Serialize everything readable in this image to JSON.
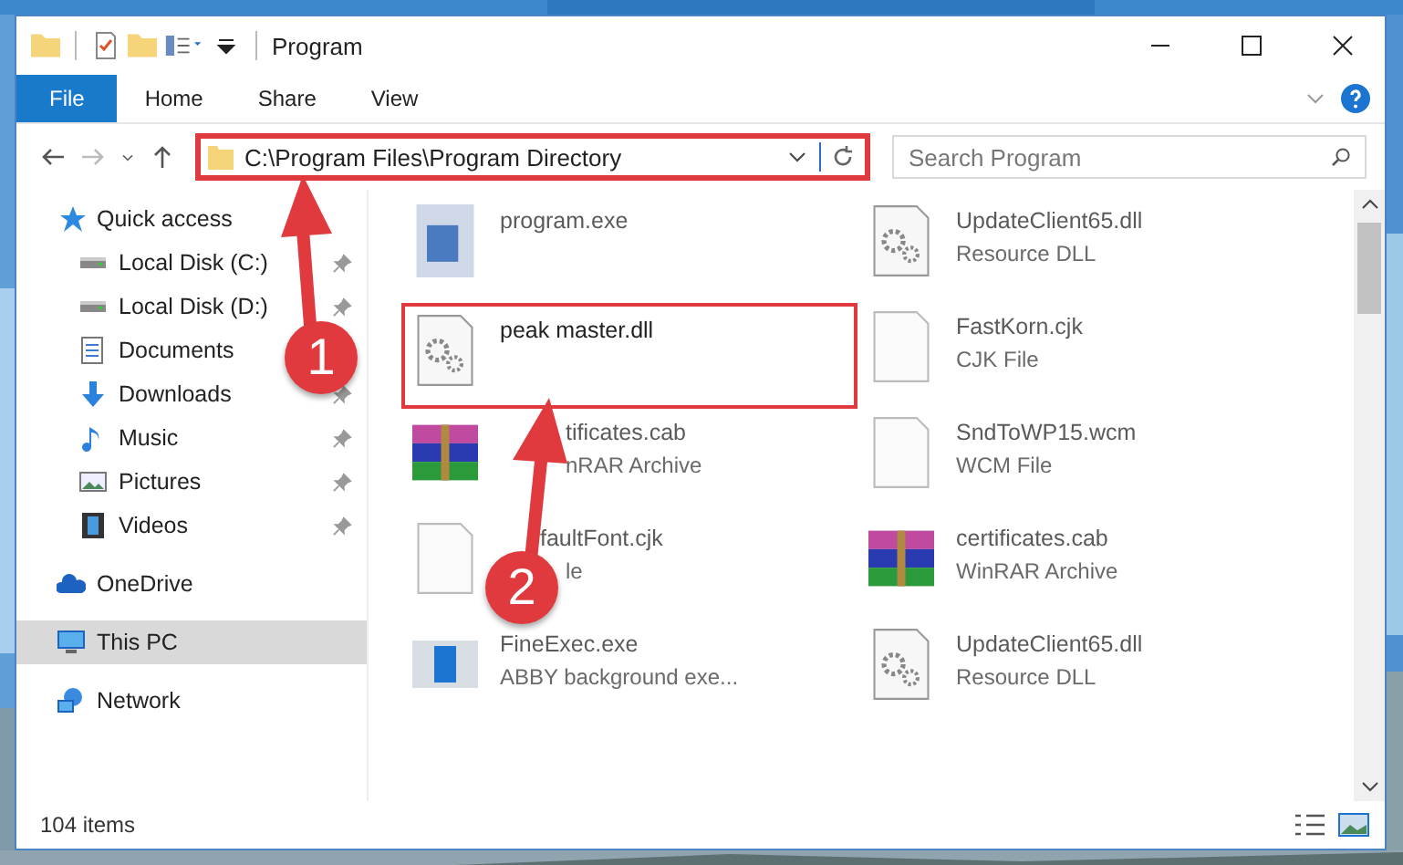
{
  "window": {
    "title": "Program"
  },
  "ribbon_tabs": [
    {
      "label": "File",
      "selected": true
    },
    {
      "label": "Home",
      "selected": false
    },
    {
      "label": "Share",
      "selected": false
    },
    {
      "label": "View",
      "selected": false
    }
  ],
  "address": {
    "value": "C:\\Program Files\\Program Directory",
    "highlighted": true
  },
  "search": {
    "placeholder": "Search Program"
  },
  "sidebar": {
    "items": [
      {
        "label": "Quick access",
        "kind": "star",
        "pinned": false,
        "selected": false,
        "group": true
      },
      {
        "label": "Local Disk (C:)",
        "kind": "disk",
        "pinned": true,
        "selected": false,
        "group": false
      },
      {
        "label": "Local Disk (D:)",
        "kind": "disk",
        "pinned": true,
        "selected": false,
        "group": false
      },
      {
        "label": "Documents",
        "kind": "docs",
        "pinned": false,
        "selected": false,
        "group": false
      },
      {
        "label": "Downloads",
        "kind": "download",
        "pinned": true,
        "selected": false,
        "group": false
      },
      {
        "label": "Music",
        "kind": "music",
        "pinned": true,
        "selected": false,
        "group": false
      },
      {
        "label": "Pictures",
        "kind": "pictures",
        "pinned": true,
        "selected": false,
        "group": false
      },
      {
        "label": "Videos",
        "kind": "videos",
        "pinned": true,
        "selected": false,
        "group": false
      },
      {
        "label": "OneDrive",
        "kind": "cloud",
        "pinned": false,
        "selected": false,
        "group": true
      },
      {
        "label": "This PC",
        "kind": "pc",
        "pinned": false,
        "selected": true,
        "group": true
      },
      {
        "label": "Network",
        "kind": "network",
        "pinned": false,
        "selected": false,
        "group": true
      }
    ]
  },
  "files": [
    {
      "name": "program.exe",
      "kind": "exe",
      "dimmed": true,
      "highlighted": false
    },
    {
      "name": "UpdateClient65.dll",
      "type": "Resource DLL",
      "kind": "dll",
      "dimmed": true,
      "highlighted": false
    },
    {
      "name": "peak master.dll",
      "kind": "dll",
      "dimmed": false,
      "highlighted": true
    },
    {
      "name": "FastKorn.cjk",
      "type": "CJK File",
      "kind": "blank",
      "dimmed": true,
      "highlighted": false
    },
    {
      "name": "tificates.cab",
      "type": "nRAR Archive",
      "kind": "rar",
      "dimmed": true,
      "highlighted": false
    },
    {
      "name": "SndToWP15.wcm",
      "type": "WCM File",
      "kind": "blank",
      "dimmed": true,
      "highlighted": false
    },
    {
      "name": "faultFont.cjk",
      "type": "le",
      "kind": "blank",
      "dimmed": true,
      "highlighted": false
    },
    {
      "name": "certificates.cab",
      "type": "WinRAR Archive",
      "kind": "rar",
      "dimmed": true,
      "highlighted": false
    },
    {
      "name": "FineExec.exe",
      "type": "ABBY background exe...",
      "kind": "app",
      "dimmed": true,
      "highlighted": false
    },
    {
      "name": "UpdateClient65.dll",
      "type": "Resource DLL",
      "kind": "dll",
      "dimmed": true,
      "highlighted": false
    }
  ],
  "status_bar": {
    "count": "104 items"
  },
  "callouts": [
    {
      "number": "1"
    },
    {
      "number": "2"
    }
  ]
}
